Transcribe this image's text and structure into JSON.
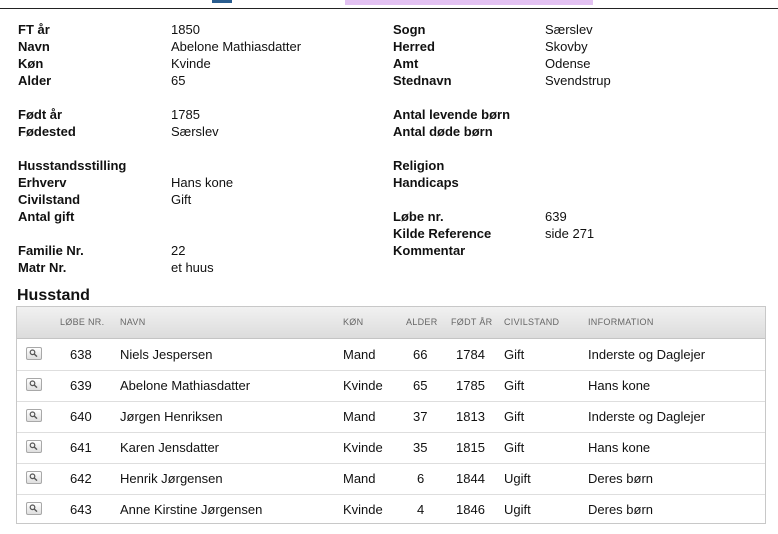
{
  "record": {
    "ft_aar": {
      "label": "FT år",
      "value": "1850"
    },
    "navn": {
      "label": "Navn",
      "value": "Abelone Mathiasdatter"
    },
    "koen": {
      "label": "Køn",
      "value": "Kvinde"
    },
    "alder": {
      "label": "Alder",
      "value": "65"
    },
    "foedt_aar": {
      "label": "Født år",
      "value": "1785"
    },
    "foedested": {
      "label": "Fødested",
      "value": "Særslev"
    },
    "husstandsstilling": {
      "label": "Husstandsstilling",
      "value": ""
    },
    "erhverv": {
      "label": "Erhverv",
      "value": "Hans kone"
    },
    "civilstand": {
      "label": "Civilstand",
      "value": "Gift"
    },
    "antal_gift": {
      "label": "Antal gift",
      "value": ""
    },
    "familie_nr": {
      "label": "Familie Nr.",
      "value": "22"
    },
    "matr_nr": {
      "label": "Matr Nr.",
      "value": "et huus"
    },
    "sogn": {
      "label": "Sogn",
      "value": "Særslev"
    },
    "herred": {
      "label": "Herred",
      "value": "Skovby"
    },
    "amt": {
      "label": "Amt",
      "value": "Odense"
    },
    "stednavn": {
      "label": "Stednavn",
      "value": "Svendstrup"
    },
    "antal_levende_boern": {
      "label": "Antal levende børn",
      "value": ""
    },
    "antal_doede_boern": {
      "label": "Antal døde børn",
      "value": ""
    },
    "religion": {
      "label": "Religion",
      "value": ""
    },
    "handicaps": {
      "label": "Handicaps",
      "value": ""
    },
    "loebe_nr": {
      "label": "Løbe nr.",
      "value": "639"
    },
    "kilde_reference": {
      "label": "Kilde Reference",
      "value": "side 271"
    },
    "kommentar": {
      "label": "Kommentar",
      "value": ""
    }
  },
  "household": {
    "title": "Husstand",
    "columns": {
      "loebe_nr": "LØBE NR.",
      "navn": "NAVN",
      "koen": "KØN",
      "alder": "ALDER",
      "foedt_aar": "FØDT ÅR",
      "civilstand": "CIVILSTAND",
      "information": "INFORMATION"
    },
    "rows": [
      {
        "loebe_nr": "638",
        "navn": "Niels Jespersen",
        "koen": "Mand",
        "alder": "66",
        "foedt_aar": "1784",
        "civilstand": "Gift",
        "information": "Inderste og Daglejer"
      },
      {
        "loebe_nr": "639",
        "navn": "Abelone Mathiasdatter",
        "koen": "Kvinde",
        "alder": "65",
        "foedt_aar": "1785",
        "civilstand": "Gift",
        "information": "Hans kone"
      },
      {
        "loebe_nr": "640",
        "navn": "Jørgen Henriksen",
        "koen": "Mand",
        "alder": "37",
        "foedt_aar": "1813",
        "civilstand": "Gift",
        "information": "Inderste og Daglejer"
      },
      {
        "loebe_nr": "641",
        "navn": "Karen Jensdatter",
        "koen": "Kvinde",
        "alder": "35",
        "foedt_aar": "1815",
        "civilstand": "Gift",
        "information": "Hans kone"
      },
      {
        "loebe_nr": "642",
        "navn": "Henrik Jørgensen",
        "koen": "Mand",
        "alder": "6",
        "foedt_aar": "1844",
        "civilstand": "Ugift",
        "information": "Deres børn"
      },
      {
        "loebe_nr": "643",
        "navn": "Anne Kirstine Jørgensen",
        "koen": "Kvinde",
        "alder": "4",
        "foedt_aar": "1846",
        "civilstand": "Ugift",
        "information": "Deres børn"
      }
    ]
  },
  "icons": {
    "row_action": "magnifier-icon"
  },
  "colors": {
    "header_bg": "#e6e6e6",
    "border": "#c8c8c8",
    "accent_pink": "#e3c2f2"
  }
}
